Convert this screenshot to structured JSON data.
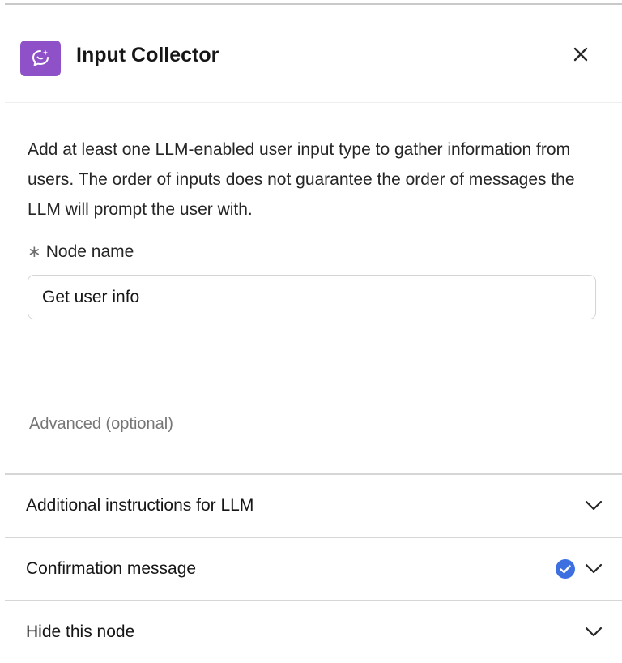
{
  "panel": {
    "title": "Input Collector",
    "icon": "chat-sparkle-icon",
    "icon_color": "#8f51c8",
    "close_icon": "close-icon"
  },
  "description": "Add at least one LLM-enabled user input type to gather information from users. The order of inputs does not guarantee the order of messages the LLM will prompt the user with.",
  "node_name": {
    "required_marker": "∗",
    "label": "Node name",
    "value": "Get user info"
  },
  "advanced": {
    "label": "Advanced (optional)"
  },
  "accordion": {
    "items": [
      {
        "label": "Additional instructions for LLM",
        "checked": false
      },
      {
        "label": "Confirmation message",
        "checked": true
      },
      {
        "label": "Hide this node",
        "checked": false
      }
    ],
    "check_color": "#3d6fe0"
  }
}
